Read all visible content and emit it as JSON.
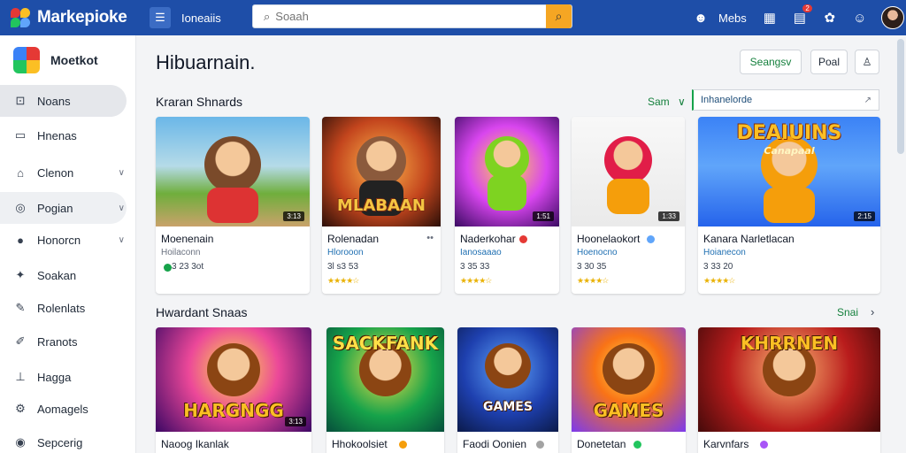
{
  "topbar": {
    "app_title": "Markepioke",
    "nav_link": "Ioneaiis",
    "search_placeholder": "Soaah",
    "user_label": "Mebs",
    "notif_count": "2"
  },
  "sidebar": {
    "brand": "Moetkot",
    "items": [
      {
        "label": "Noans",
        "icon": "inbox-icon",
        "glyph": "⊡",
        "state": "active",
        "chevron": false
      },
      {
        "label": "Hnenas",
        "icon": "monitor-icon",
        "glyph": "▭",
        "state": "",
        "chevron": false
      },
      {
        "label": "Clenon",
        "icon": "bag-icon",
        "glyph": "⌂",
        "state": "",
        "chevron": true
      },
      {
        "label": "Pogian",
        "icon": "cloud-icon",
        "glyph": "◎",
        "state": "hover",
        "chevron": true
      },
      {
        "label": "Honorcn",
        "icon": "circle-badge-icon",
        "glyph": "●",
        "state": "",
        "chevron": true
      },
      {
        "label": "Soakan",
        "icon": "puzzle-icon",
        "glyph": "✦",
        "state": "",
        "chevron": false
      },
      {
        "label": "Rolenlats",
        "icon": "wrench-icon",
        "glyph": "✎",
        "state": "",
        "chevron": false
      },
      {
        "label": "Rranots",
        "icon": "pen-icon",
        "glyph": "✐",
        "state": "",
        "chevron": false
      },
      {
        "label": "Hagga",
        "icon": "chart-icon",
        "glyph": "⊥",
        "state": "",
        "chevron": false
      },
      {
        "label": "Aomagels",
        "icon": "gear-icon",
        "glyph": "⚙",
        "state": "",
        "chevron": false
      },
      {
        "label": "Sepcerig",
        "icon": "settings-icon",
        "glyph": "◉",
        "state": "",
        "chevron": false
      }
    ]
  },
  "main": {
    "title": "Hibuarnain.",
    "btn_primary": "Seangsv",
    "btn_secondary": "Poal",
    "section1": {
      "title": "Kraran Shnards",
      "see_all": "Sam",
      "filter_value": "Inhanelorde"
    },
    "section2": {
      "title": "Hwardant Snaas",
      "see_all": "Snai"
    },
    "row1": [
      {
        "title": "Moenenain",
        "sub": "Hoilaconn",
        "price": "3 23 3ot",
        "stars": "",
        "time": "3:13",
        "banner": "",
        "badge": "",
        "sub_color": "#6b7280"
      },
      {
        "title": "Rolenadan",
        "sub": "Hlorooon",
        "price": "3l s3 53",
        "stars": "★★★★☆",
        "time": "",
        "banner": "MLABAAN",
        "badge": "",
        "sub_color": "#1f6fb2"
      },
      {
        "title": "Naderkohar",
        "sub": "Ianosaaao",
        "price": "3 35 33",
        "stars": "★★★★☆",
        "time": "1:51",
        "banner": "",
        "badge": "#e53935",
        "sub_color": "#1f6fb2"
      },
      {
        "title": "Hoonelaokort",
        "sub": "Hoenocno",
        "price": "3 30 35",
        "stars": "★★★★☆",
        "time": "1:33",
        "banner": "",
        "badge": "#60a5fa",
        "sub_color": "#1f6fb2"
      },
      {
        "title": "Kanara Narletlacan",
        "sub": "Hoianecon",
        "price": "3 33 20",
        "stars": "★★★★☆",
        "time": "2:15",
        "banner": "DEAIUINS",
        "banner2": "Canapaal",
        "badge": "",
        "sub_color": "#1f6fb2"
      }
    ],
    "row2": [
      {
        "title": "Naoog Ikanlak",
        "time": "3:13",
        "banner": "HARGNGG",
        "badge": ""
      },
      {
        "title": "Hhokoolsiet",
        "time": "",
        "banner": "SACKFANK",
        "badge": "#f59e0b"
      },
      {
        "title": "Faodi Oonien",
        "time": "",
        "banner": "GAMES",
        "badge": "#a3a3a3"
      },
      {
        "title": "Donetetan",
        "time": "",
        "banner": "GAMES",
        "badge": "#22c55e"
      },
      {
        "title": "Karvnfars",
        "time": "",
        "banner": "KHRRNEN",
        "badge": "#a855f7"
      }
    ],
    "colors": {
      "topbar": "#1e4ea8",
      "accent_green": "#15803d",
      "search_button": "#f5a623"
    }
  }
}
